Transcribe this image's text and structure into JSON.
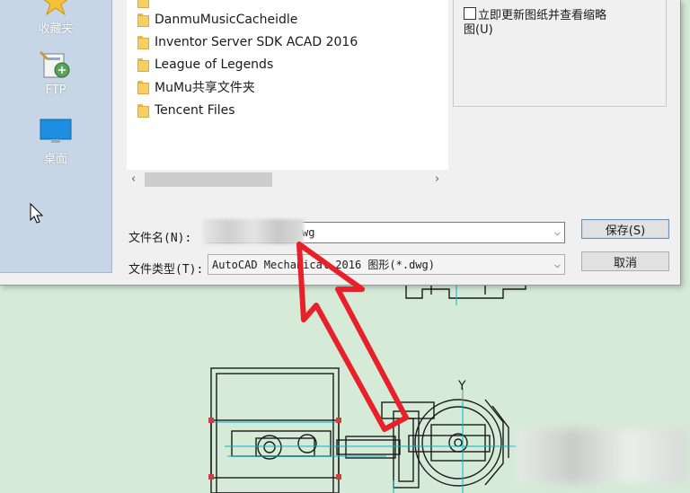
{
  "sidebar": {
    "items": [
      {
        "label": "收藏夹",
        "icon": "star-icon"
      },
      {
        "label": "FTP",
        "icon": "ftp-icon"
      },
      {
        "label": "桌面",
        "icon": "desktop-icon"
      }
    ]
  },
  "files": [
    {
      "name": "DanmuMusicCacheidle"
    },
    {
      "name": "Inventor Server SDK ACAD 2016"
    },
    {
      "name": "League of Legends"
    },
    {
      "name": "MuMu共享文件夹"
    },
    {
      "name": "Tencent Files"
    }
  ],
  "preview": {
    "thumbnail_option": "立即更新图纸并查看缩略图(U)",
    "thumbnail_checked": false
  },
  "filename": {
    "label": "文件名(N):",
    "value_visible": "wg"
  },
  "filetype": {
    "label": "文件类型(T):",
    "value": "AutoCAD Mechanical 2016 图形(*.dwg)"
  },
  "buttons": {
    "save": "保存(S)",
    "cancel": "取消"
  },
  "cad": {
    "axis_label": "Y"
  },
  "colors": {
    "annotation_arrow": "#e8202a",
    "sidebar_bg": "#c7d6e6",
    "canvas_bg": "#d5ead7"
  }
}
